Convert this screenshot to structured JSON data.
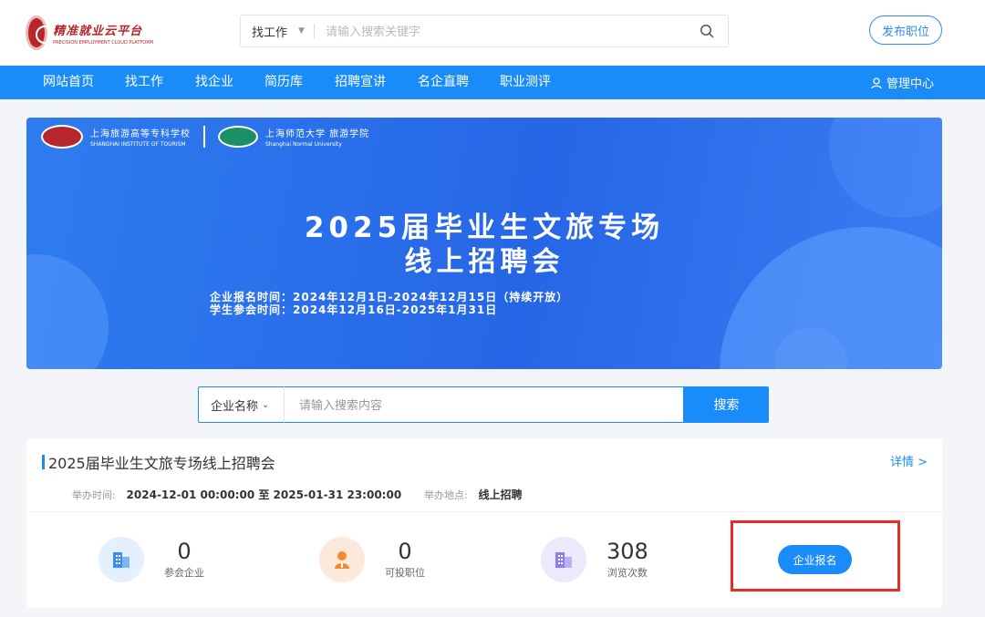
{
  "site": {
    "logo_title": "精准就业云平台",
    "logo_sub": "PRECISION EMPLOYMENT CLOUD PLATFORM"
  },
  "search_top": {
    "type_label": "找工作",
    "placeholder": "请输入搜索关键字"
  },
  "header": {
    "post_job_label": "发布职位"
  },
  "nav": {
    "items": [
      "网站首页",
      "找工作",
      "找企业",
      "简历库",
      "招聘宣讲",
      "名企直聘",
      "职业测评"
    ],
    "admin_label": "管理中心"
  },
  "banner": {
    "school1_cn": "上海旅游高等专科学校",
    "school1_en": "SHANGHAI INSTITUTE OF TOURISM",
    "school2_cn": "上海师范大学 旅游学院",
    "school2_en": "Shanghai Normal University",
    "title_line1": "2025届毕业生文旅专场",
    "title_line2": "线上招聘会",
    "date_line1": "企业报名时间：2024年12月1日-2024年12月15日（持续开放）",
    "date_line2": "学生参会时间：2024年12月16日-2025年1月31日"
  },
  "search_mid": {
    "select_label": "企业名称",
    "placeholder": "请输入搜索内容",
    "button_label": "搜索"
  },
  "fair": {
    "title": "2025届毕业生文旅专场线上招聘会",
    "detail_label": "详情 >",
    "time_label": "举办时间:",
    "time_value": "2024-12-01 00:00:00 至 2025-01-31 23:00:00",
    "place_label": "举办地点:",
    "place_value": "线上招聘",
    "stats": [
      {
        "value": "0",
        "label": "参会企业",
        "icon": "building-icon",
        "color": "#3b8bf5"
      },
      {
        "value": "0",
        "label": "可投职位",
        "icon": "person-icon",
        "color": "#f5892d"
      },
      {
        "value": "308",
        "label": "浏览次数",
        "icon": "building-icon",
        "color": "#8b7ff0"
      }
    ],
    "enroll_label": "企业报名"
  },
  "colors": {
    "primary": "#1a8cfa",
    "highlight": "#ee2a24",
    "brand_red": "#b8262b"
  }
}
